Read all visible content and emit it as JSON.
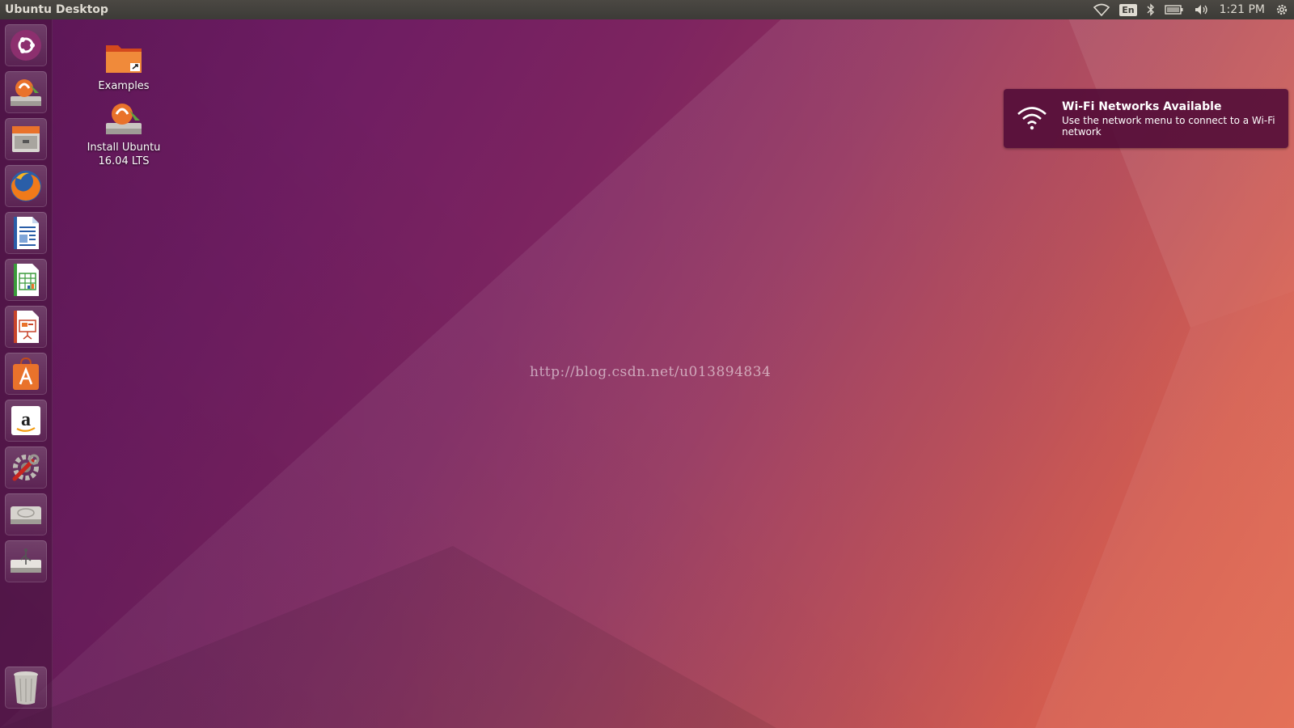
{
  "panel": {
    "title": "Ubuntu Desktop",
    "language": "En",
    "clock": "1:21 PM",
    "icons": [
      "wifi-icon",
      "keyboard-language-icon",
      "bluetooth-icon",
      "battery-icon",
      "volume-icon",
      "gear-icon"
    ]
  },
  "launcher": {
    "items": [
      {
        "name": "ubuntu-dash",
        "icon": "ubuntu-logo-icon"
      },
      {
        "name": "install-ubuntu",
        "icon": "installer-icon"
      },
      {
        "name": "files",
        "icon": "file-cabinet-icon"
      },
      {
        "name": "firefox",
        "icon": "firefox-icon"
      },
      {
        "name": "libreoffice-writer",
        "icon": "writer-icon"
      },
      {
        "name": "libreoffice-calc",
        "icon": "calc-icon"
      },
      {
        "name": "libreoffice-impress",
        "icon": "impress-icon"
      },
      {
        "name": "ubuntu-software",
        "icon": "software-bag-icon"
      },
      {
        "name": "amazon",
        "icon": "amazon-icon"
      },
      {
        "name": "system-settings",
        "icon": "settings-wrench-icon"
      },
      {
        "name": "disk-drive",
        "icon": "hard-disk-icon"
      },
      {
        "name": "usb-drive",
        "icon": "usb-drive-icon"
      },
      {
        "name": "trash",
        "icon": "trash-icon"
      }
    ]
  },
  "desktop": {
    "icons": [
      {
        "label": "Examples",
        "icon": "folder-link-icon"
      },
      {
        "label_line1": "Install Ubuntu",
        "label_line2": "16.04 LTS",
        "icon": "installer-icon"
      }
    ]
  },
  "notification": {
    "title": "Wi-Fi Networks Available",
    "body": "Use the network menu to connect to a Wi-Fi network",
    "icon": "wifi-icon"
  },
  "watermark": "http://blog.csdn.net/u013894834",
  "colors": {
    "panel": "#3c3b37",
    "panel_text": "#dfdbd2",
    "notification_bg": "#500a37",
    "wallpaper_left": "#5d1658",
    "wallpaper_right": "#e0583a"
  }
}
